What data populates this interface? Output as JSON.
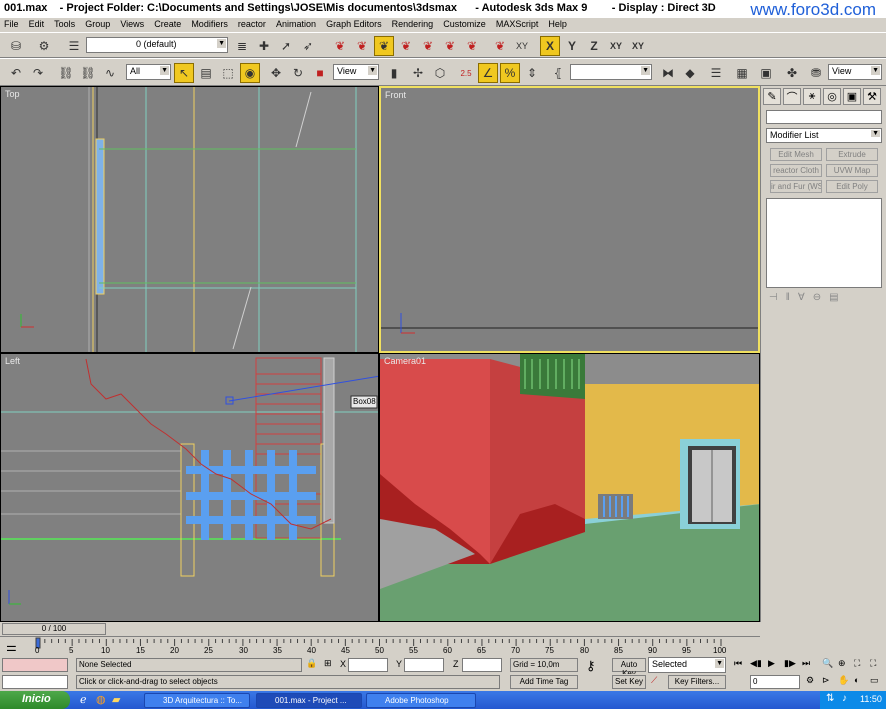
{
  "titlebar": {
    "title": "001.max    - Project Folder: C:\\Documents and Settings\\JOSE\\Mis documentos\\3dsmax      - Autodesk 3ds Max 9        - Display : Direct 3D",
    "watermark": "www.foro3d.com"
  },
  "menu": [
    "File",
    "Edit",
    "Tools",
    "Group",
    "Views",
    "Create",
    "Modifiers",
    "reactor",
    "Animation",
    "Graph Editors",
    "Rendering",
    "Customize",
    "MAXScript",
    "Help"
  ],
  "toolbar1": {
    "layer_value": "0 (default)",
    "axis_x": "X",
    "axis_y": "Y",
    "axis_z": "Z",
    "axis_xy": "XY",
    "axis_xy2": "XY"
  },
  "toolbar2": {
    "selection_filter": "All",
    "ref_coord": "View",
    "named_sel": "",
    "view_right": "View",
    "snap_label": "2.5"
  },
  "viewports": {
    "top": "Top",
    "front": "Front",
    "left": "Left",
    "camera": "Camera01",
    "box_label": "Box08"
  },
  "command_panel": {
    "modifier_list": "Modifier List",
    "buttons": [
      "Edit Mesh",
      "Extrude",
      "reactor Cloth",
      "UVW Map",
      "ir and Fur (WS",
      "Edit Poly"
    ]
  },
  "timeline": {
    "slider": "0 / 100",
    "ticks": [
      "0",
      "5",
      "10",
      "15",
      "20",
      "25",
      "30",
      "35",
      "40",
      "45",
      "50",
      "55",
      "60",
      "65",
      "70",
      "75",
      "80",
      "85",
      "90",
      "95",
      "100"
    ]
  },
  "status": {
    "selection": "None Selected",
    "prompt": "Click or click-and-drag to select objects",
    "x_label": "X",
    "y_label": "Y",
    "z_label": "Z",
    "grid": "Grid = 10,0m",
    "add_time_tag": "Add Time Tag",
    "auto_key": "Auto Key",
    "set_key": "Set Key",
    "selected": "Selected",
    "key_filters": "Key Filters...",
    "frame": "0"
  },
  "taskbar": {
    "start": "Inicio",
    "tasks": [
      "3D Arquitectura :: To...",
      "001.max    - Project ...",
      "Adobe Photoshop"
    ],
    "clock": "11:50"
  }
}
